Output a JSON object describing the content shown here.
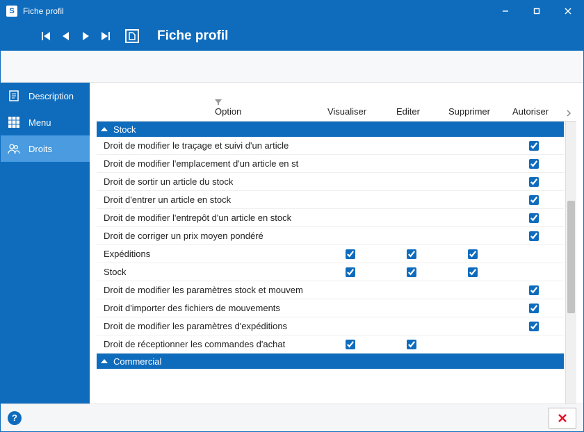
{
  "titlebar": {
    "title": "Fiche profil",
    "app_letter": "S"
  },
  "ribbon": {
    "title": "Fiche profil"
  },
  "sidebar": {
    "items": [
      {
        "label": "Description",
        "icon": "document-icon"
      },
      {
        "label": "Menu",
        "icon": "grid-icon"
      },
      {
        "label": "Droits",
        "icon": "users-icon"
      }
    ],
    "active_index": 2
  },
  "grid": {
    "columns": {
      "option": "Option",
      "visualiser": "Visualiser",
      "editer": "Editer",
      "supprimer": "Supprimer",
      "autoriser": "Autoriser"
    },
    "groups": [
      {
        "name": "Stock",
        "rows": [
          {
            "option": "Droit de modifier le traçage et suivi d'un article",
            "visualiser": null,
            "editer": null,
            "supprimer": null,
            "autoriser": true
          },
          {
            "option": "Droit de modifier l'emplacement d'un article en st",
            "visualiser": null,
            "editer": null,
            "supprimer": null,
            "autoriser": true
          },
          {
            "option": "Droit de sortir un article du stock",
            "visualiser": null,
            "editer": null,
            "supprimer": null,
            "autoriser": true
          },
          {
            "option": "Droit d'entrer un article en stock",
            "visualiser": null,
            "editer": null,
            "supprimer": null,
            "autoriser": true
          },
          {
            "option": "Droit de modifier l'entrepôt d'un article en stock",
            "visualiser": null,
            "editer": null,
            "supprimer": null,
            "autoriser": true
          },
          {
            "option": "Droit de corriger un prix moyen pondéré",
            "visualiser": null,
            "editer": null,
            "supprimer": null,
            "autoriser": true
          },
          {
            "option": "Expéditions",
            "visualiser": true,
            "editer": true,
            "supprimer": true,
            "autoriser": null
          },
          {
            "option": "Stock",
            "visualiser": true,
            "editer": true,
            "supprimer": true,
            "autoriser": null
          },
          {
            "option": "Droit de modifier les paramètres stock et mouvem",
            "visualiser": null,
            "editer": null,
            "supprimer": null,
            "autoriser": true
          },
          {
            "option": "Droit d'importer des fichiers de mouvements",
            "visualiser": null,
            "editer": null,
            "supprimer": null,
            "autoriser": true
          },
          {
            "option": "Droit de modifier les paramètres d'expéditions",
            "visualiser": null,
            "editer": null,
            "supprimer": null,
            "autoriser": true
          },
          {
            "option": "Droit de réceptionner les commandes d'achat",
            "visualiser": true,
            "editer": true,
            "supprimer": null,
            "autoriser": null
          }
        ]
      },
      {
        "name": "Commercial",
        "rows": []
      }
    ]
  },
  "bottom": {
    "help": "?",
    "close": "×"
  }
}
